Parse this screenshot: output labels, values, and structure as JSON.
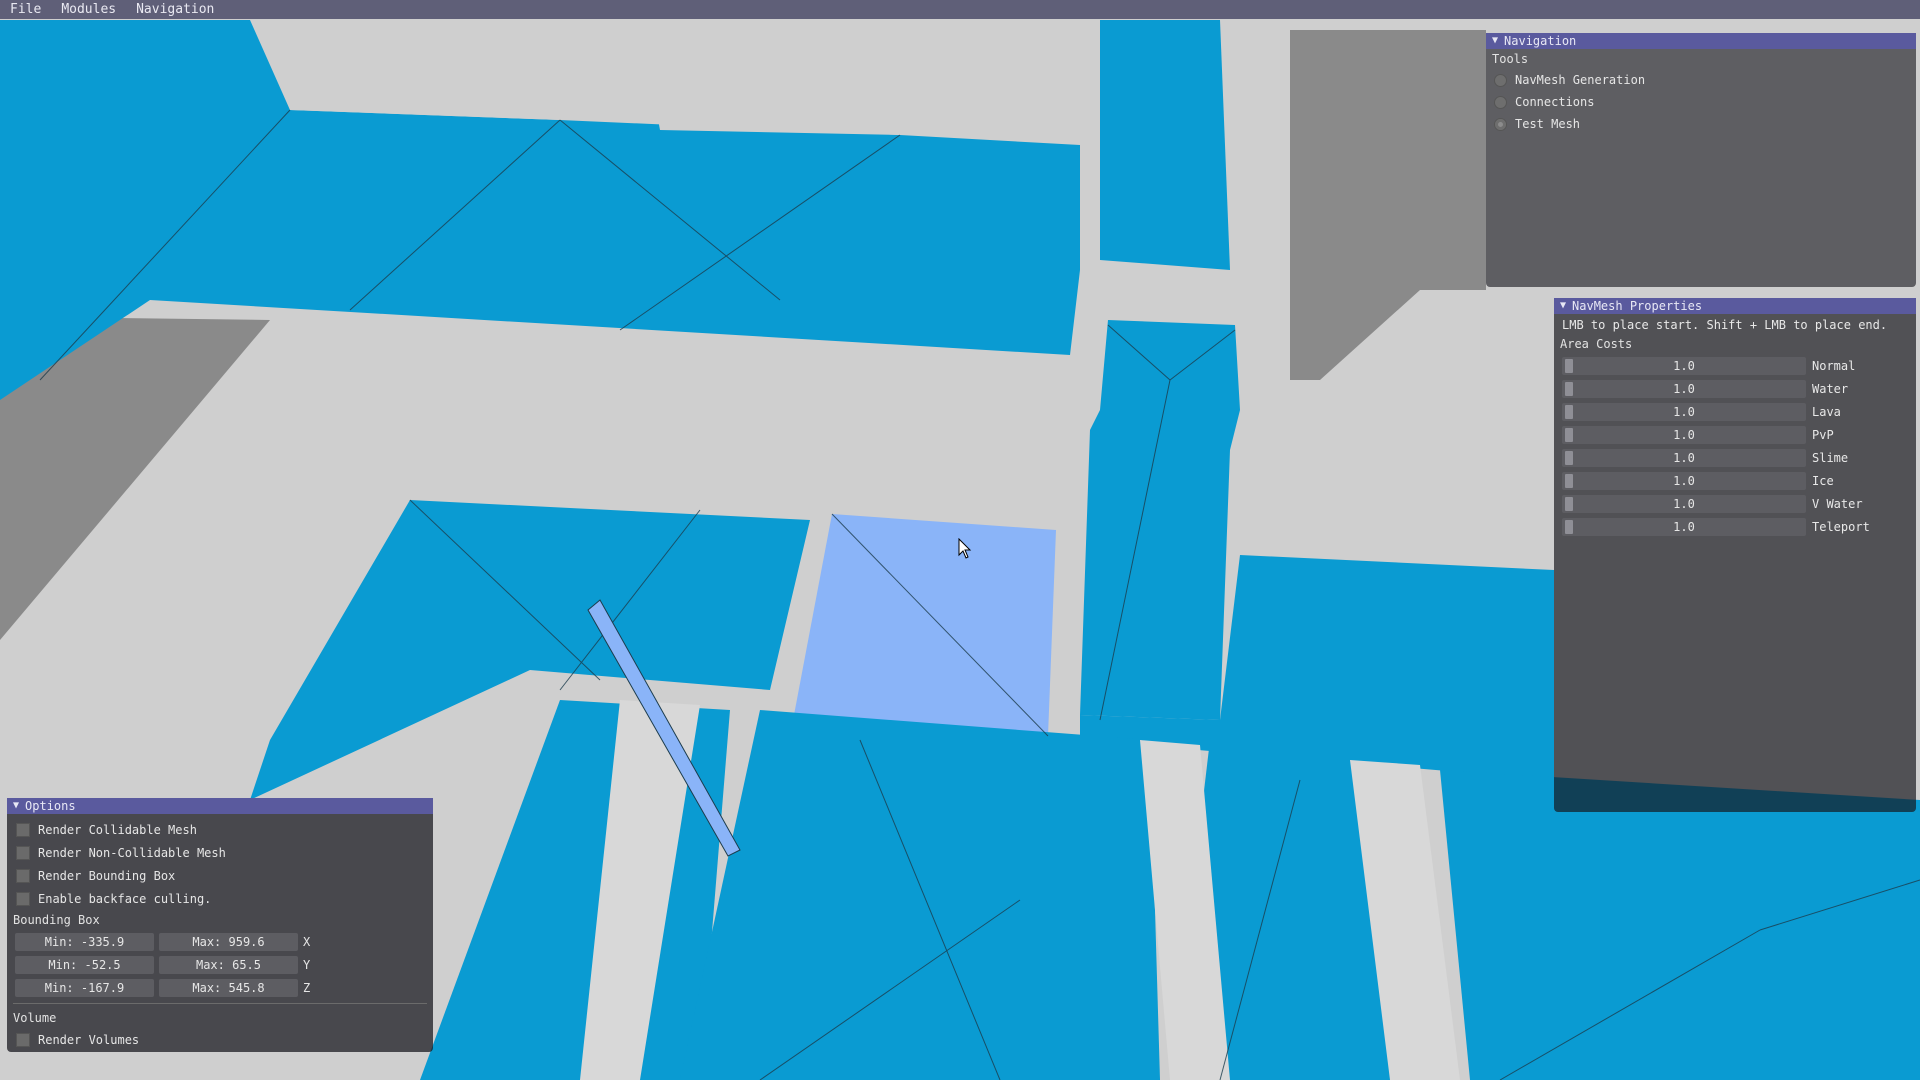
{
  "menubar": {
    "items": [
      "File",
      "Modules",
      "Navigation"
    ]
  },
  "navigation_panel": {
    "title": "Navigation",
    "tools_label": "Tools",
    "tools": [
      {
        "label": "NavMesh Generation",
        "selected": false
      },
      {
        "label": "Connections",
        "selected": false
      },
      {
        "label": "Test Mesh",
        "selected": true
      }
    ]
  },
  "navmesh_properties": {
    "title": "NavMesh Properties",
    "hint": "LMB to place start. Shift + LMB to place end.",
    "area_costs_label": "Area Costs",
    "area_costs": [
      {
        "label": "Normal",
        "value": "1.0"
      },
      {
        "label": "Water",
        "value": "1.0"
      },
      {
        "label": "Lava",
        "value": "1.0"
      },
      {
        "label": "PvP",
        "value": "1.0"
      },
      {
        "label": "Slime",
        "value": "1.0"
      },
      {
        "label": "Ice",
        "value": "1.0"
      },
      {
        "label": "V Water",
        "value": "1.0"
      },
      {
        "label": "Teleport",
        "value": "1.0"
      }
    ]
  },
  "options_panel": {
    "title": "Options",
    "checks": [
      {
        "label": "Render Collidable Mesh",
        "checked": false
      },
      {
        "label": "Render Non-Collidable Mesh",
        "checked": false
      },
      {
        "label": "Render Bounding Box",
        "checked": false
      },
      {
        "label": "Enable backface culling.",
        "checked": false
      }
    ],
    "bounding_box_label": "Bounding Box",
    "bounding_box": [
      {
        "min": "Min: -335.9",
        "max": "Max: 959.6",
        "axis": "X"
      },
      {
        "min": "Min: -52.5",
        "max": "Max: 65.5",
        "axis": "Y"
      },
      {
        "min": "Min: -167.9",
        "max": "Max: 545.8",
        "axis": "Z"
      }
    ],
    "volume_label": "Volume",
    "volume_check": {
      "label": "Render Volumes",
      "checked": false
    }
  },
  "colors": {
    "navmesh_blue": "#0a9bd2",
    "highlight_blue": "#8ab4f8",
    "floor_gray": "#cfcfcf",
    "wall_gray": "#8a8a8a",
    "panel_header": "#5a5a9e"
  }
}
